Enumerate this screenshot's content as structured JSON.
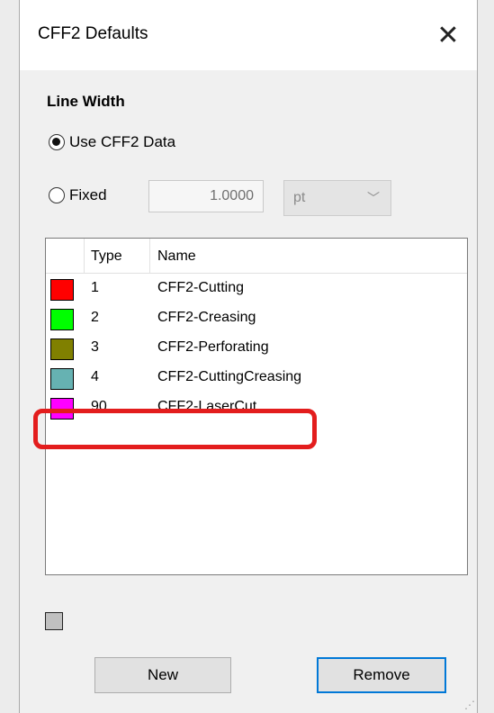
{
  "window": {
    "title": "CFF2 Defaults",
    "close_glyph": "✕"
  },
  "line_width": {
    "section_label": "Line Width",
    "options": [
      {
        "label": "Use CFF2 Data",
        "selected": true
      },
      {
        "label": "Fixed",
        "selected": false
      }
    ],
    "fixed_value": "1.0000",
    "unit": "pt"
  },
  "table": {
    "headers": [
      "",
      "Type",
      "Name"
    ],
    "rows": [
      {
        "color": "#ff0000",
        "type": "1",
        "name": "CFF2-Cutting"
      },
      {
        "color": "#00ff00",
        "type": "2",
        "name": "CFF2-Creasing"
      },
      {
        "color": "#808000",
        "type": "3",
        "name": "CFF2-Perforating"
      },
      {
        "color": "#66b2b2",
        "type": "4",
        "name": "CFF2-CuttingCreasing"
      },
      {
        "color": "#ff00ff",
        "type": "90",
        "name": "CFF2-LaserCut"
      }
    ],
    "highlighted_row": 4
  },
  "color_preview": {
    "color": "#c0c0c0"
  },
  "buttons": {
    "new_label": "New",
    "remove_label": "Remove"
  },
  "colors": {
    "focus_border": "#0078d7",
    "annotation_highlight": "#e31d1d"
  }
}
